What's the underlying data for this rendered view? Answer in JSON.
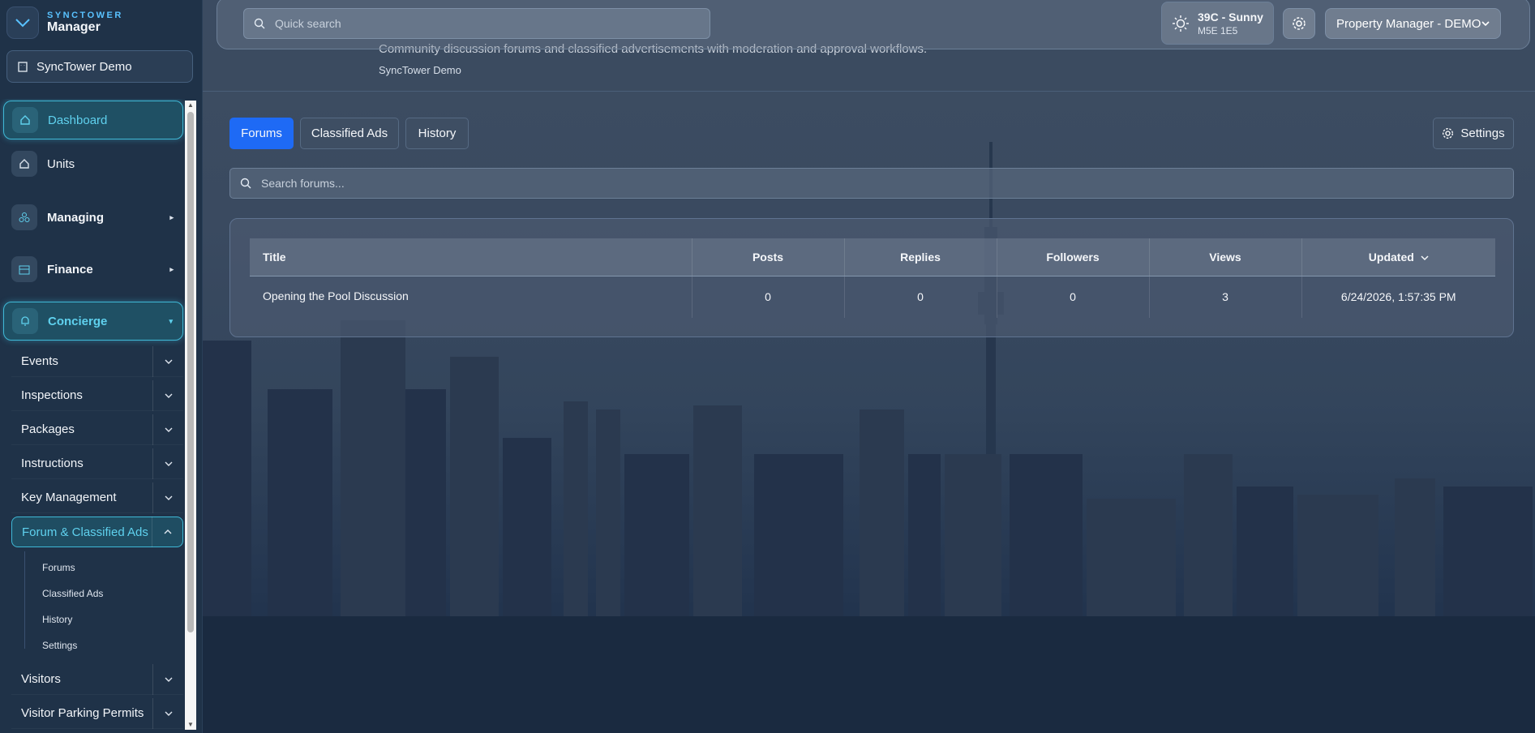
{
  "brand": {
    "top": "SYNCTOWER",
    "bottom": "Manager"
  },
  "org_selector": {
    "label": "SyncTower Demo"
  },
  "sidebar": {
    "items": [
      {
        "label": "Dashboard",
        "icon": "home-icon"
      },
      {
        "label": "Units",
        "icon": "home-icon"
      },
      {
        "label": "Managing",
        "icon": "cluster-icon"
      },
      {
        "label": "Finance",
        "icon": "building-icon"
      },
      {
        "label": "Concierge",
        "icon": "bell-icon"
      }
    ],
    "concierge_sub": [
      {
        "label": "Events"
      },
      {
        "label": "Inspections"
      },
      {
        "label": "Packages"
      },
      {
        "label": "Instructions"
      },
      {
        "label": "Key Management"
      },
      {
        "label": "Forum & Classified Ads"
      },
      {
        "label": "Visitors"
      },
      {
        "label": "Visitor Parking Permits"
      }
    ],
    "forum_leaves": [
      {
        "label": "Forums"
      },
      {
        "label": "Classified Ads"
      },
      {
        "label": "History"
      },
      {
        "label": "Settings"
      }
    ]
  },
  "header": {
    "search_placeholder": "Quick search",
    "description": "Community discussion forums and classified advertisements with moderation and approval workflows.",
    "org": "SyncTower Demo",
    "weather": {
      "summary": "39C - Sunny",
      "postal": "M5E 1E5"
    },
    "role": "Property Manager - DEMO"
  },
  "tabs": [
    {
      "label": "Forums",
      "active": true
    },
    {
      "label": "Classified Ads",
      "active": false
    },
    {
      "label": "History",
      "active": false
    }
  ],
  "settings_label": "Settings",
  "forum_search_placeholder": "Search forums...",
  "table": {
    "columns": [
      "Title",
      "Posts",
      "Replies",
      "Followers",
      "Views",
      "Updated"
    ],
    "rows": [
      {
        "title": "Opening the Pool Discussion",
        "posts": "0",
        "replies": "0",
        "followers": "0",
        "views": "3",
        "updated": "6/24/2026, 1:57:35 PM"
      }
    ]
  },
  "colors": {
    "accent": "#1e6af5",
    "active_nav": "#5fd1ee",
    "brand": "#59c2ff"
  }
}
